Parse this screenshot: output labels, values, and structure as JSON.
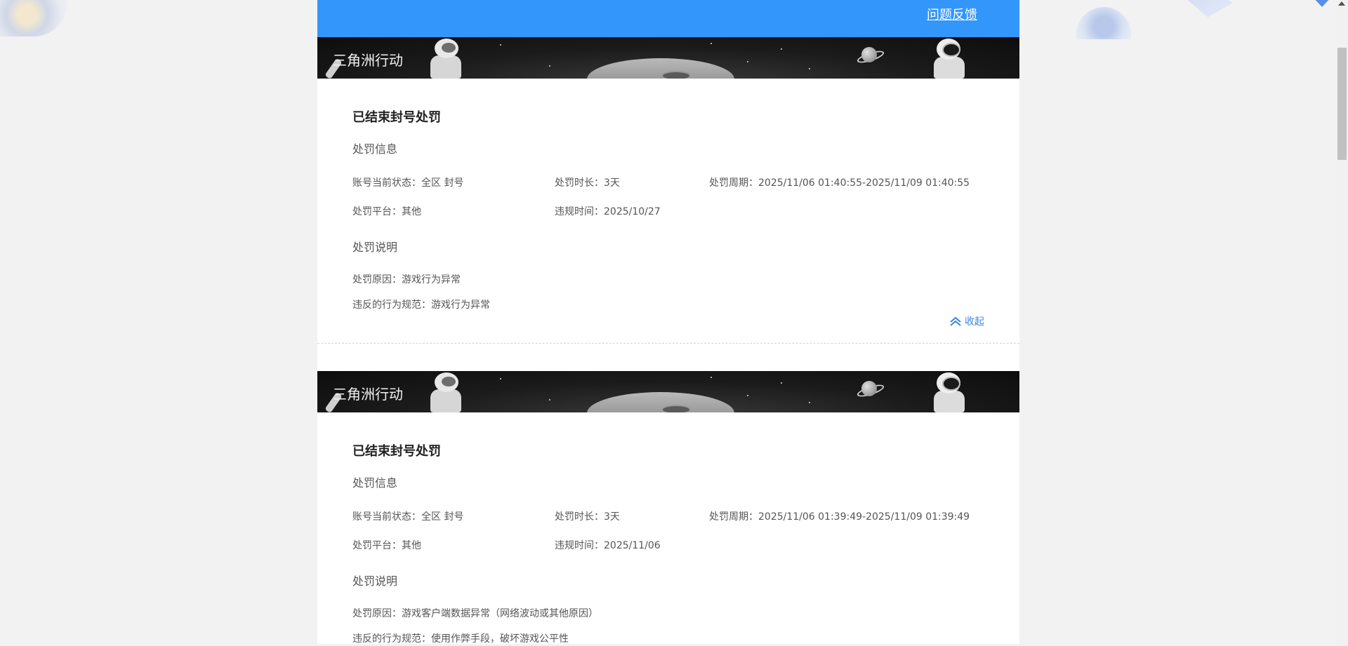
{
  "header": {
    "feedback_label": "问题反馈"
  },
  "cards": [
    {
      "banner_title": "三角洲行动",
      "status_title": "已结束封号处罚",
      "penalty_info_label": "处罚信息",
      "fields": {
        "account_status": "账号当前状态：全区 封号",
        "duration": "处罚时长：3天",
        "period": "处罚周期：2025/11/06 01:40:55-2025/11/09 01:40:55",
        "platform": "处罚平台：其他",
        "violation_time": "违规时间：2025/10/27"
      },
      "explanation_label": "处罚说明",
      "reason": "处罚原因：游戏行为异常",
      "rule": "违反的行为规范：游戏行为异常",
      "collapse_label": "收起"
    },
    {
      "banner_title": "三角洲行动",
      "status_title": "已结束封号处罚",
      "penalty_info_label": "处罚信息",
      "fields": {
        "account_status": "账号当前状态：全区 封号",
        "duration": "处罚时长：3天",
        "period": "处罚周期：2025/11/06 01:39:49-2025/11/09 01:39:49",
        "platform": "处罚平台：其他",
        "violation_time": "违规时间：2025/11/06"
      },
      "explanation_label": "处罚说明",
      "reason": "处罚原因：游戏客户端数据异常（网络波动或其他原因）",
      "rule": "违反的行为规范：使用作弊手段，破坏游戏公平性"
    }
  ],
  "colors": {
    "accent": "#3396fb",
    "link": "#3a86e8"
  }
}
